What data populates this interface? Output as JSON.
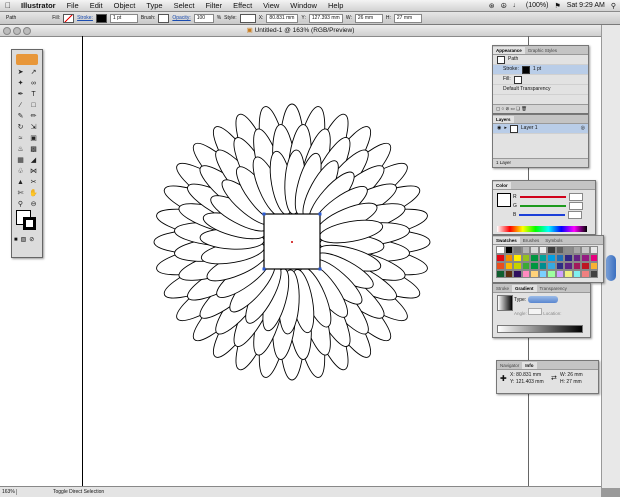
{
  "menubar": {
    "items": [
      "Illustrator",
      "File",
      "Edit",
      "Object",
      "Type",
      "Select",
      "Filter",
      "Effect",
      "View",
      "Window",
      "Help"
    ],
    "status": {
      "battery": "(100%)",
      "clock": "Sat 9:29 AM"
    }
  },
  "control_bar": {
    "selection_label": "Path",
    "fill_label": "Fill:",
    "stroke_link": "Stroke:",
    "stroke_weight": "1 pt",
    "brush_label": "Brush:",
    "opacity_link": "Opacity:",
    "opacity_value": "100",
    "opacity_unit": "%",
    "style_label": "Style:",
    "x_label": "X:",
    "x_value": "80.831 mm",
    "y_label": "Y:",
    "y_value": "127.393 mm",
    "w_label": "W:",
    "w_value": "26 mm",
    "h_label": "H:",
    "h_value": "27 mm"
  },
  "document": {
    "title": "Untitled-1 @ 163% (RGB/Preview)"
  },
  "statusbar": {
    "zoom": "163%",
    "status": "Toggle Direct Selection"
  },
  "appearance_panel": {
    "tabs": [
      "Appearance",
      "Graphic Styles"
    ],
    "object": "Path",
    "stroke_label": "Stroke:",
    "stroke_value": "1 pt",
    "fill_label": "Fill:",
    "transparency": "Default Transparency"
  },
  "layers_panel": {
    "tabs": [
      "Layers"
    ],
    "layer_name": "Layer 1",
    "footer": "1 Layer"
  },
  "color_panel": {
    "tabs": [
      "Color"
    ],
    "channels": [
      {
        "name": "R",
        "color": "#d0021b"
      },
      {
        "name": "G",
        "color": "#1d9a1d"
      },
      {
        "name": "B",
        "color": "#1c3fd8"
      }
    ]
  },
  "swatches_panel": {
    "tabs": [
      "Swatches",
      "Brushes",
      "Symbols"
    ],
    "colors": [
      "#ffffff",
      "#000000",
      "#7a7a7a",
      "#b5b5b5",
      "#d9d9d9",
      "#ececec",
      "#3c3c3c",
      "#5e5e5e",
      "#8c8c8c",
      "#a8a8a8",
      "#c9c9c9",
      "#e8e8e8",
      "#e30613",
      "#f39200",
      "#ffed00",
      "#95c11f",
      "#009640",
      "#00a19a",
      "#009fe3",
      "#1d71b8",
      "#312783",
      "#662483",
      "#951b81",
      "#e6007e",
      "#e94e1b",
      "#fbba00",
      "#c6d300",
      "#3aaa35",
      "#00963f",
      "#008d8f",
      "#36a9e1",
      "#2d2e83",
      "#5c2483",
      "#a2195b",
      "#be1622",
      "#f9b233",
      "#0f5f2f",
      "#5f2f0f",
      "#2f0f5f",
      "#ff8ac0",
      "#ffd27a",
      "#7ad0ff",
      "#9effa0",
      "#d0a0ff",
      "#f0f080",
      "#80f0f0",
      "#f08080",
      "#404040"
    ]
  },
  "gradient_panel": {
    "tabs": [
      "Stroke",
      "Gradient",
      "Transparency"
    ],
    "type_label": "Type:",
    "angle_label": "Angle:",
    "location_label": "Location:"
  },
  "info_panel": {
    "tabs": [
      "Navigator",
      "Info"
    ],
    "x_label": "X:",
    "x_value": "80.831 mm",
    "y_label": "Y:",
    "y_value": "121.403 mm",
    "w_label": "W:",
    "w_value": "26 mm",
    "h_label": "H:",
    "h_value": "27 mm"
  }
}
